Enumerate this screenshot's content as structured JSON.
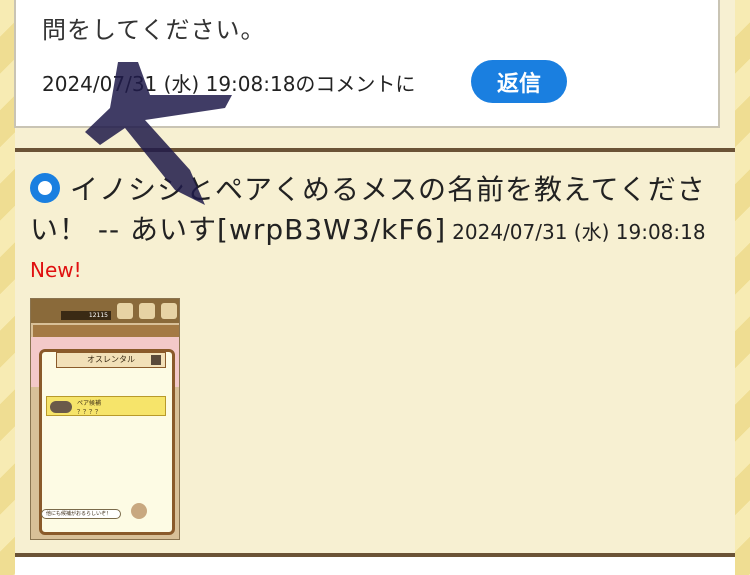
{
  "previous_comment": {
    "text_tail": "問をしてください。",
    "timestamp": "2024/07/31 (水) 19:08:18",
    "comment_suffix": "のコメントに",
    "reply_label": "返信"
  },
  "post": {
    "title": "イノシシとペアくめるメスの名前を教えてください！",
    "author_sep": " -- ",
    "author": "あいす[wrpB3W3/kF6]",
    "timestamp": "2024/07/31 (水) 19:08:18",
    "new_badge": "New!"
  },
  "thumbnail": {
    "money": "12115",
    "dialog_title": "オスレンタル",
    "pair_label": "ペア候補",
    "pair_value": "？？？？",
    "bubble_text": "他にも候補がおるらしいぞ！"
  },
  "colors": {
    "accent_blue": "#1a7fe0",
    "new_red": "#e01010",
    "divider_brown": "#6b5336",
    "scribble": "#1e1a4a"
  }
}
